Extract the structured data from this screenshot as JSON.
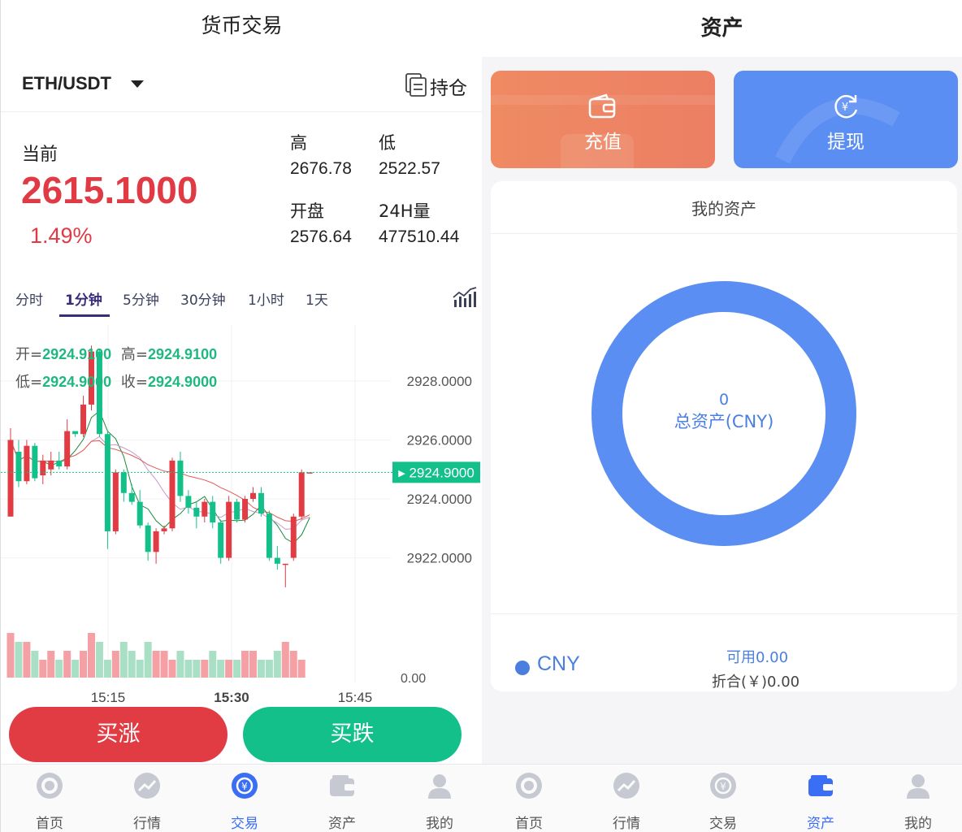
{
  "left": {
    "title": "货币交易",
    "pair": "ETH/USDT",
    "holdings_label": "持仓",
    "current_label": "当前",
    "price": "2615.1000",
    "change_pct": "1.49%",
    "stats": {
      "high_label": "高",
      "high": "2676.78",
      "low_label": "低",
      "low": "2522.57",
      "open_label": "开盘",
      "open": "2576.64",
      "vol_label": "24H量",
      "vol": "477510.44"
    },
    "intervals": [
      "分时",
      "1分钟",
      "5分钟",
      "30分钟",
      "1小时",
      "1天"
    ],
    "active_interval": "1分钟",
    "ohlc": {
      "open_label": "开=",
      "open": "2924.9100",
      "high_label": "高=",
      "high": "2924.9100",
      "low_label": "低=",
      "low": "2924.9000",
      "close_label": "收=",
      "close": "2924.9000"
    },
    "buy_up": "买涨",
    "buy_down": "买跌"
  },
  "chart_data": {
    "type": "candlestick",
    "y_ticks": [
      "2928.0000",
      "2926.0000",
      "2924.0000",
      "2922.0000"
    ],
    "ylim": [
      2919.7,
      2929.9
    ],
    "last_price": "2924.9000",
    "volume_label": "0.00",
    "x_ticks": [
      "15:15",
      "15:30",
      "15:45"
    ],
    "candles": [
      {
        "o": 2923.4,
        "c": 2926.0,
        "h": 2926.4,
        "l": 2923.4
      },
      {
        "o": 2925.6,
        "c": 2924.6,
        "h": 2926.0,
        "l": 2924.4
      },
      {
        "o": 2924.6,
        "c": 2925.8,
        "h": 2926.0,
        "l": 2924.5
      },
      {
        "o": 2925.8,
        "c": 2924.7,
        "h": 2925.9,
        "l": 2924.6
      },
      {
        "o": 2924.8,
        "c": 2925.3,
        "h": 2925.5,
        "l": 2924.5
      },
      {
        "o": 2925.0,
        "c": 2925.3,
        "h": 2925.6,
        "l": 2924.8
      },
      {
        "o": 2925.3,
        "c": 2925.1,
        "h": 2925.6,
        "l": 2925.0
      },
      {
        "o": 2925.1,
        "c": 2926.3,
        "h": 2926.7,
        "l": 2925.0
      },
      {
        "o": 2926.3,
        "c": 2926.2,
        "h": 2926.3,
        "l": 2926.1
      },
      {
        "o": 2926.2,
        "c": 2927.2,
        "h": 2927.5,
        "l": 2926.1
      },
      {
        "o": 2927.2,
        "c": 2929.0,
        "h": 2929.2,
        "l": 2927.0
      },
      {
        "o": 2929.0,
        "c": 2926.2,
        "h": 2929.1,
        "l": 2926.1
      },
      {
        "o": 2926.2,
        "c": 2922.9,
        "h": 2926.3,
        "l": 2922.3
      },
      {
        "o": 2922.9,
        "c": 2924.9,
        "h": 2925.0,
        "l": 2922.8
      },
      {
        "o": 2924.9,
        "c": 2924.2,
        "h": 2925.0,
        "l": 2923.9
      },
      {
        "o": 2924.2,
        "c": 2923.9,
        "h": 2924.5,
        "l": 2923.8
      },
      {
        "o": 2923.9,
        "c": 2923.1,
        "h": 2924.3,
        "l": 2923.0
      },
      {
        "o": 2923.1,
        "c": 2922.2,
        "h": 2923.2,
        "l": 2921.9
      },
      {
        "o": 2922.2,
        "c": 2922.9,
        "h": 2923.0,
        "l": 2921.8
      },
      {
        "o": 2922.9,
        "c": 2923.0,
        "h": 2923.1,
        "l": 2922.8
      },
      {
        "o": 2923.0,
        "c": 2925.3,
        "h": 2925.4,
        "l": 2922.9
      },
      {
        "o": 2925.3,
        "c": 2924.1,
        "h": 2925.6,
        "l": 2923.9
      },
      {
        "o": 2924.1,
        "c": 2923.7,
        "h": 2924.3,
        "l": 2923.5
      },
      {
        "o": 2923.7,
        "c": 2923.4,
        "h": 2923.9,
        "l": 2923.0
      },
      {
        "o": 2923.4,
        "c": 2923.9,
        "h": 2924.0,
        "l": 2923.2
      },
      {
        "o": 2923.9,
        "c": 2923.2,
        "h": 2924.1,
        "l": 2923.0
      },
      {
        "o": 2923.2,
        "c": 2922.0,
        "h": 2923.3,
        "l": 2921.8
      },
      {
        "o": 2922.0,
        "c": 2923.9,
        "h": 2924.1,
        "l": 2921.9
      },
      {
        "o": 2923.9,
        "c": 2923.3,
        "h": 2924.0,
        "l": 2923.2
      },
      {
        "o": 2923.3,
        "c": 2924.0,
        "h": 2924.1,
        "l": 2923.2
      },
      {
        "o": 2924.0,
        "c": 2924.2,
        "h": 2924.4,
        "l": 2923.9
      },
      {
        "o": 2924.2,
        "c": 2923.5,
        "h": 2924.4,
        "l": 2923.4
      },
      {
        "o": 2923.5,
        "c": 2922.0,
        "h": 2923.6,
        "l": 2921.9
      },
      {
        "o": 2922.0,
        "c": 2921.8,
        "h": 2922.4,
        "l": 2921.6
      },
      {
        "o": 2921.8,
        "c": 2921.8,
        "h": 2921.8,
        "l": 2921.0
      },
      {
        "o": 2922.0,
        "c": 2923.4,
        "h": 2923.5,
        "l": 2921.9
      },
      {
        "o": 2923.4,
        "c": 2924.9,
        "h": 2925.0,
        "l": 2923.3
      },
      {
        "o": 2924.9,
        "c": 2924.9,
        "h": 2924.9,
        "l": 2924.9
      }
    ],
    "volumes": [
      5,
      4,
      4,
      3,
      2,
      3,
      2,
      3,
      2,
      3,
      5,
      4,
      2,
      3,
      4,
      3,
      2,
      4,
      3,
      3,
      2,
      3,
      2,
      2,
      2,
      3,
      2,
      2,
      2,
      3,
      3,
      2,
      2,
      3,
      4,
      3,
      2,
      0
    ]
  },
  "right": {
    "title": "资产",
    "recharge": "充值",
    "withdraw": "提现",
    "my_assets": "我的资产",
    "total_value": "0",
    "total_label": "总资产(CNY)",
    "currency": "CNY",
    "available": "可用0.00",
    "equivalent": "折合(￥)0.00"
  },
  "tabbar_left": [
    {
      "label": "首页",
      "icon": "home-icon"
    },
    {
      "label": "行情",
      "icon": "market-icon"
    },
    {
      "label": "交易",
      "icon": "trade-icon"
    },
    {
      "label": "资产",
      "icon": "wallet-icon"
    },
    {
      "label": "我的",
      "icon": "profile-icon"
    }
  ],
  "tabbar_right": [
    {
      "label": "首页",
      "icon": "home-icon"
    },
    {
      "label": "行情",
      "icon": "market-icon"
    },
    {
      "label": "交易",
      "icon": "trade-icon"
    },
    {
      "label": "资产",
      "icon": "wallet-icon"
    },
    {
      "label": "我的",
      "icon": "profile-icon"
    }
  ],
  "colors": {
    "up": "#e13c44",
    "down": "#14c08a",
    "accent": "#3a6ef5",
    "donut": "#5b8ef2"
  }
}
